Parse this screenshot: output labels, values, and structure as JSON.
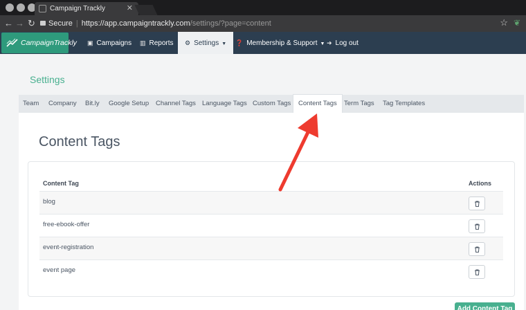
{
  "browser": {
    "tab_title": "Campaign Trackly",
    "tab_close": "✕",
    "secure_label": "Secure",
    "url_host": "https://app.campaigntrackly.com",
    "url_path": "/settings/?page=content"
  },
  "navbar": {
    "logo_text": "CampaignTrackly",
    "items": [
      {
        "label": "Campaigns",
        "icon": "briefcase-icon"
      },
      {
        "label": "Reports",
        "icon": "bar-chart-icon"
      },
      {
        "label": "Settings",
        "icon": "gears-icon"
      },
      {
        "label": "Membership & Support",
        "icon": "question-icon"
      },
      {
        "label": "Log out",
        "icon": "sign-out-icon"
      }
    ]
  },
  "page": {
    "title": "Settings",
    "tabs": [
      "Team",
      "Company",
      "Bit.ly",
      "Google Setup",
      "Channel Tags",
      "Language Tags",
      "Custom Tags",
      "Content Tags",
      "Term Tags",
      "Tag Templates"
    ],
    "active_tab": "Content Tags",
    "section_title": "Content Tags",
    "table": {
      "headers": [
        "Content Tag",
        "Actions"
      ],
      "rows": [
        "blog",
        "free-ebook-offer",
        "event-registration",
        "event page"
      ]
    },
    "add_button": "Add Content Tag"
  },
  "colors": {
    "accent": "#48b08f",
    "navbar": "#2c3e50",
    "annotation_arrow": "#ee3b2f"
  }
}
